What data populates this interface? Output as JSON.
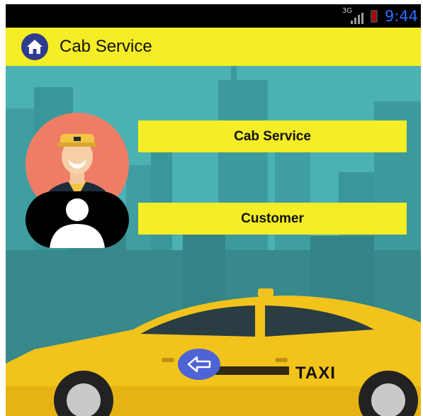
{
  "status_bar": {
    "network": "3G",
    "time": "9:44"
  },
  "app_bar": {
    "title": "Cab Service",
    "home_icon": "home-icon"
  },
  "roles": [
    {
      "label": "Cab Service",
      "avatar_icon": "driver-avatar-icon"
    },
    {
      "label": "Customer",
      "avatar_icon": "user-avatar-icon"
    }
  ],
  "back_button": {
    "icon": "back-arrow-icon"
  },
  "car_sign": {
    "text": "TAXI"
  },
  "colors": {
    "app_bar": "#f5ed25",
    "background": "#4bb1b3",
    "home_button": "#2d3c8e",
    "driver_avatar": "#ef7d66",
    "back_button": "#4d63d6",
    "status_time": "#2f6cff"
  }
}
